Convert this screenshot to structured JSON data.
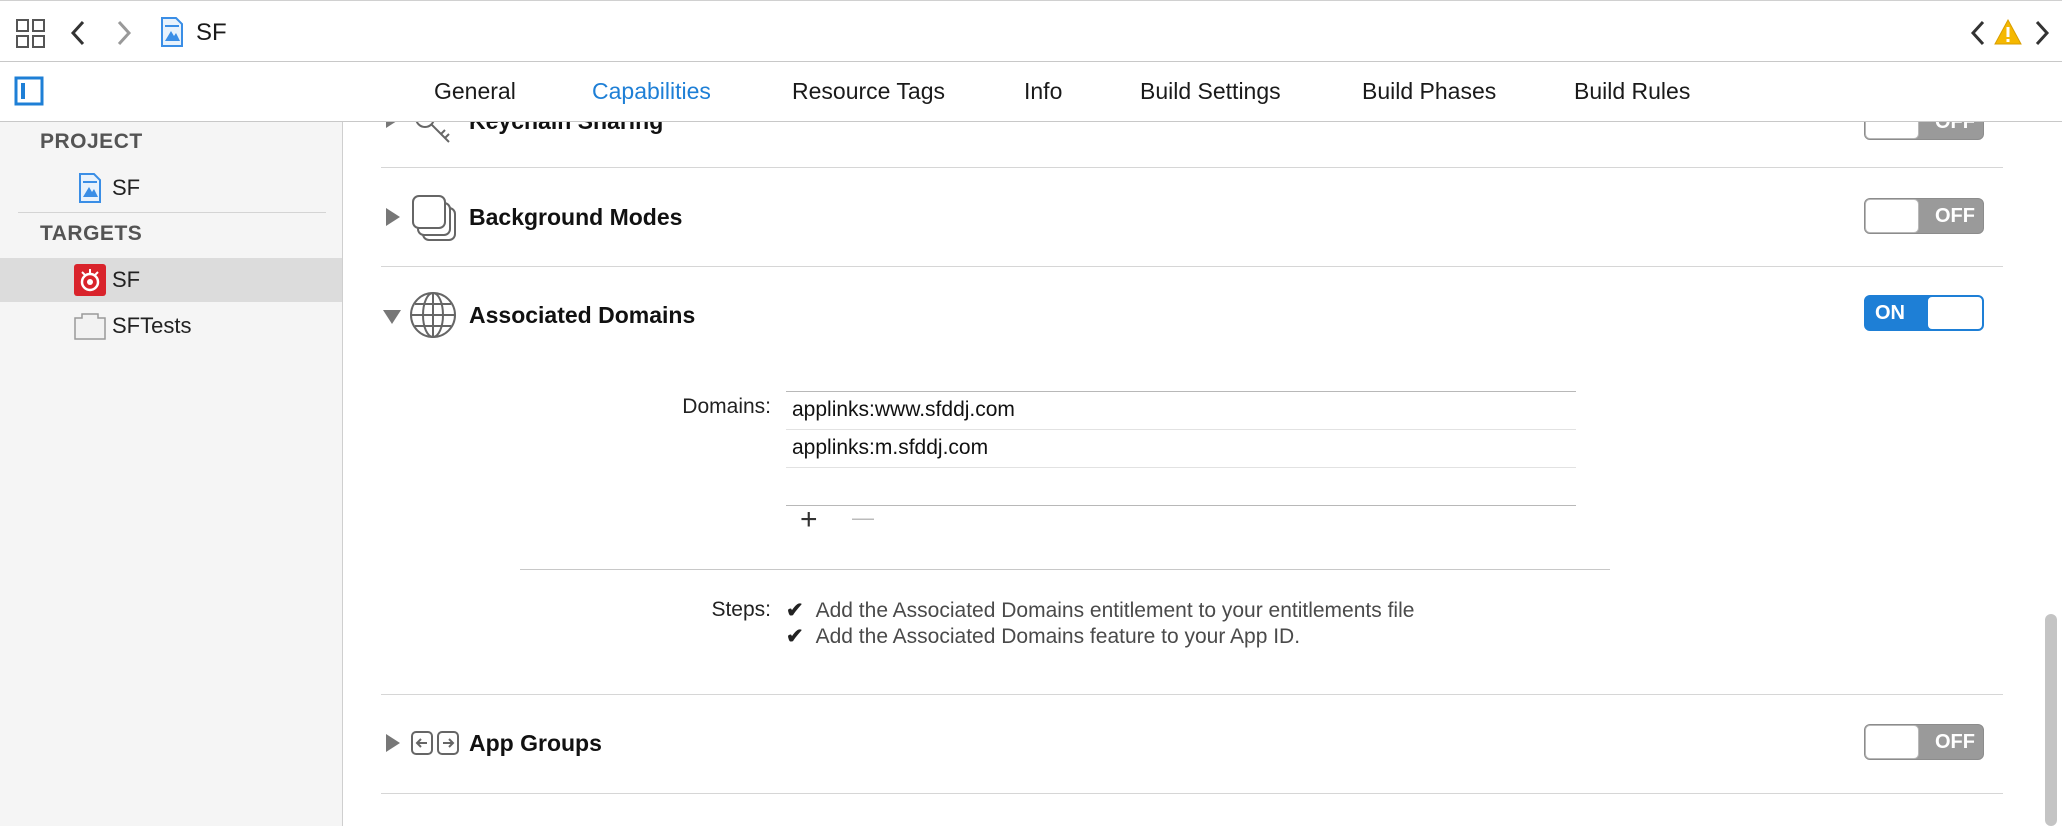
{
  "jumpbar": {
    "title": "SF",
    "icons": [
      "related-items-grid-icon",
      "back-chevron-icon",
      "forward-chevron-icon",
      "project-file-icon",
      "previous-issue-icon",
      "warning-icon",
      "next-issue-icon"
    ]
  },
  "tabs": [
    {
      "label": "General",
      "active": false
    },
    {
      "label": "Capabilities",
      "active": true
    },
    {
      "label": "Resource Tags",
      "active": false
    },
    {
      "label": "Info",
      "active": false
    },
    {
      "label": "Build Settings",
      "active": false
    },
    {
      "label": "Build Phases",
      "active": false
    },
    {
      "label": "Build Rules",
      "active": false
    }
  ],
  "sidebar": {
    "project_header": "PROJECT",
    "project_item": "SF",
    "targets_header": "TARGETS",
    "targets": [
      {
        "label": "SF",
        "selected": true
      },
      {
        "label": "SFTests",
        "selected": false
      }
    ]
  },
  "capabilities": [
    {
      "title": "Keychain Sharing",
      "state": "OFF",
      "expanded": false
    },
    {
      "title": "Background Modes",
      "state": "OFF",
      "expanded": false
    },
    {
      "title": "Associated Domains",
      "state": "ON",
      "expanded": true
    },
    {
      "title": "App Groups",
      "state": "OFF",
      "expanded": false
    }
  ],
  "associated_domains": {
    "domains_label": "Domains:",
    "domains": [
      "applinks:www.sfddj.com",
      "applinks:m.sfddj.com"
    ],
    "add_symbol": "+",
    "remove_symbol": "—",
    "steps_label": "Steps:",
    "check_symbol": "✔",
    "steps": [
      "Add the Associated Domains entitlement to your entitlements file",
      "Add the Associated Domains feature to your App ID."
    ]
  },
  "colors": {
    "accent": "#1e7fd6",
    "warning": "#f5b800",
    "toggle_off": "#9a9a9a",
    "sidebar_bg": "#f5f5f5",
    "selected_row": "#dcdcdc"
  }
}
